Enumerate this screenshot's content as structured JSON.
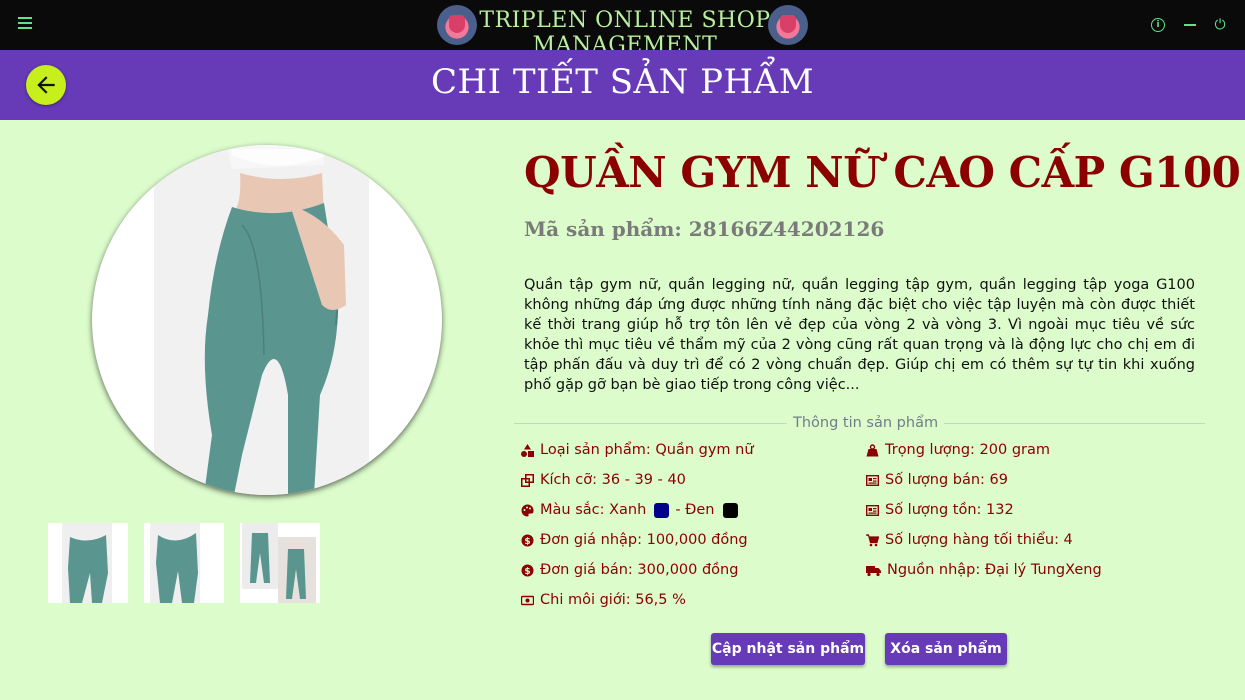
{
  "app": {
    "title": "TRIPLEN ONLINE SHOP MANAGEMENT"
  },
  "header": {
    "title": "CHI TIẾT SẢN PHẨM"
  },
  "product": {
    "name": "QUẦN GYM NỮ CAO CẤP G100",
    "code": "Mã sản phẩm: 28166Z44202126",
    "description": "Quần tập gym nữ, quần legging nữ, quần legging tập gym, quần legging tập yoga G100 không những đáp ứng được những tính năng đặc biệt cho việc tập luyện mà còn được thiết kế thời trang giúp hỗ trợ tôn lên vẻ đẹp của vòng 2 và vòng 3. Vì ngoài mục tiêu về sức khỏe thì mục tiêu về thẩm mỹ của 2 vòng cũng rất quan trọng và là động lực cho chị em đi tập phấn đấu và duy trì để có 2 vòng chuẩn đẹp. Giúp chị em có thêm sự tự tin khi xuống phố gặp gỡ bạn bè giao tiếp trong công việc..."
  },
  "info": {
    "section_label": "Thông tin sản phẩm",
    "category": "Loại sản phẩm: Quần gym nữ",
    "sizes": "Kích cỡ: 36 - 39 - 40",
    "colors_prefix": "Màu sắc: Xanh",
    "colors_sep": "- Đen",
    "import_price": "Đơn giá nhập: 100,000 đồng",
    "sale_price": "Đơn giá bán: 300,000 đồng",
    "commission": "Chi môi giới: 56,5 %",
    "weight": "Trọng lượng: 200 gram",
    "sold": "Số lượng bán: 69",
    "stock": "Số lượng tồn: 132",
    "min_stock": "Số lượng hàng tối thiểu: 4",
    "source": "Nguồn nhập: Đại lý TungXeng"
  },
  "colors": {
    "accent": "#673ab7",
    "title": "#8b0000",
    "background": "#dcfccc",
    "swatch_blue": "#00008b",
    "swatch_black": "#000000",
    "back_button": "#c6ef1c"
  },
  "buttons": {
    "update": "Cập nhật sản phẩm",
    "delete": "Xóa sản phẩm"
  }
}
